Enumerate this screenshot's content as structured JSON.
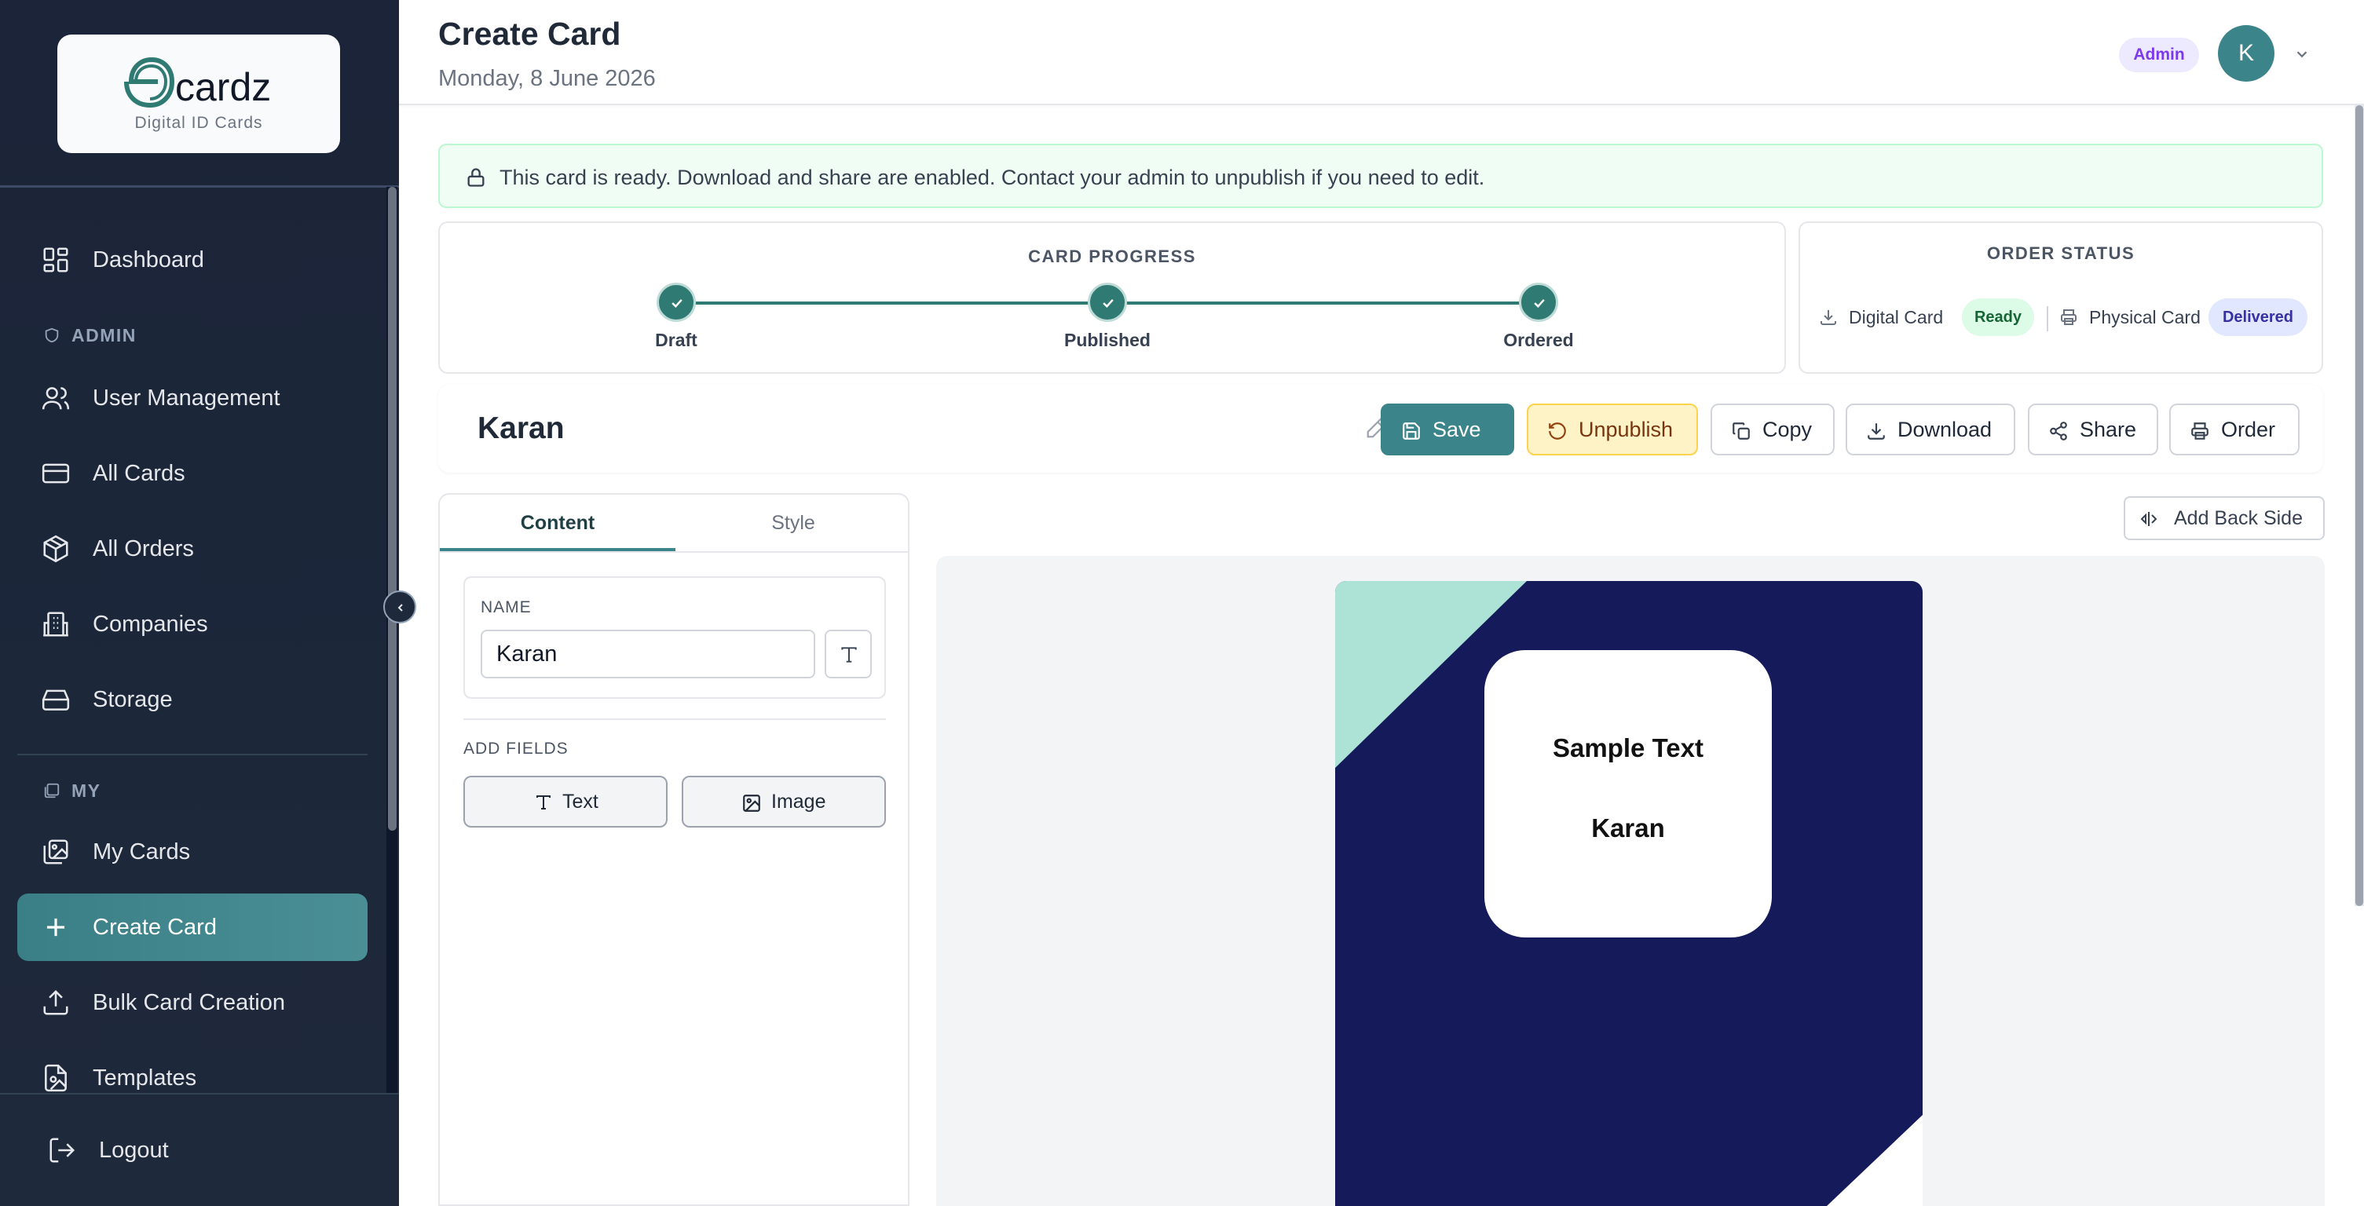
{
  "brand": {
    "logo_letter": "e",
    "logo_word": "cardz",
    "subtitle": "Digital ID Cards"
  },
  "sidebar": {
    "items": [
      {
        "label": "Dashboard",
        "icon": "dashboard-icon"
      },
      {
        "label": "User Management",
        "icon": "users-icon"
      },
      {
        "label": "All Cards",
        "icon": "card-icon"
      },
      {
        "label": "All Orders",
        "icon": "box-icon"
      },
      {
        "label": "Companies",
        "icon": "building-icon"
      },
      {
        "label": "Storage",
        "icon": "drive-icon"
      },
      {
        "label": "My Cards",
        "icon": "images-icon"
      },
      {
        "label": "Create Card",
        "icon": "plus-icon",
        "active": true
      },
      {
        "label": "Bulk Card Creation",
        "icon": "upload-icon"
      },
      {
        "label": "Templates",
        "icon": "template-icon"
      }
    ],
    "sections": {
      "admin": "ADMIN",
      "my": "MY"
    },
    "logout": "Logout"
  },
  "header": {
    "title": "Create Card",
    "date": "Monday, 8 June 2026",
    "role": "Admin",
    "avatar_initial": "K"
  },
  "alert": {
    "text": "This card is ready. Download and share are enabled. Contact your admin to unpublish if you need to edit."
  },
  "progress": {
    "title": "CARD PROGRESS",
    "steps": [
      "Draft",
      "Published",
      "Ordered"
    ],
    "completed": 3
  },
  "order_status": {
    "title": "ORDER STATUS",
    "digital_label": "Digital Card",
    "digital_status": "Ready",
    "physical_label": "Physical Card",
    "physical_status": "Delivered"
  },
  "card": {
    "name": "Karan",
    "buttons": {
      "save": "Save",
      "unpublish": "Unpublish",
      "copy": "Copy",
      "download": "Download",
      "share": "Share",
      "order": "Order"
    }
  },
  "editor": {
    "tabs": [
      "Content",
      "Style"
    ],
    "name_label": "NAME",
    "name_value": "Karan",
    "add_fields_label": "ADD FIELDS",
    "add_text": "Text",
    "add_image": "Image"
  },
  "preview": {
    "add_back_side": "Add Back Side",
    "sample_text": "Sample Text",
    "name_text": "Karan"
  },
  "colors": {
    "accent": "#3b8489",
    "sidebar_bg": "#1e293b",
    "card_bg": "#151a5a",
    "card_accent": "#ade3d7"
  }
}
